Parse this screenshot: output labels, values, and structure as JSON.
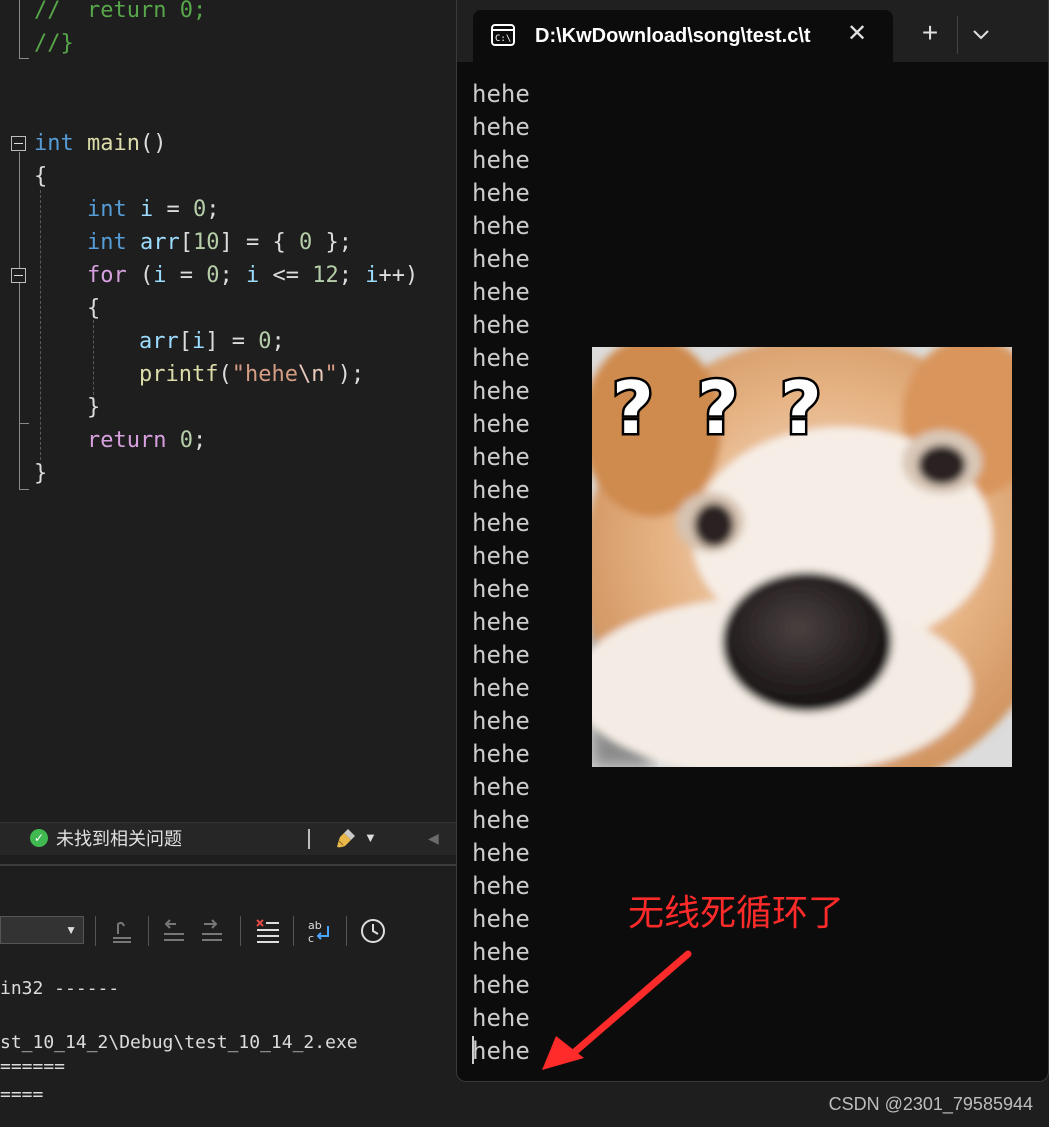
{
  "editor": {
    "lines": {
      "comment1_a": "//  ",
      "comment1_b": "return 0;",
      "comment2": "//}",
      "main_kw": "int",
      "main_fn": "main",
      "main_parens": "()",
      "open_brace": "{",
      "decl_i_kw": "int",
      "decl_i_name": "i",
      "decl_i_rest": " = ",
      "decl_i_val": "0",
      "decl_i_end": ";",
      "decl_arr_kw": "int",
      "decl_arr_name": "arr",
      "decl_arr_open": "[",
      "decl_arr_size": "10",
      "decl_arr_mid": "] = { ",
      "decl_arr_val": "0",
      "decl_arr_end": " };",
      "for_kw": "for",
      "for_a": " (",
      "for_i1": "i",
      "for_b": " = ",
      "for_n0": "0",
      "for_c": "; ",
      "for_i2": "i",
      "for_d": " <= ",
      "for_n12": "12",
      "for_e": "; ",
      "for_i3": "i",
      "for_f": "++)",
      "inner_open": "{",
      "assign_arr": "arr",
      "assign_open": "[",
      "assign_i": "i",
      "assign_mid": "] = ",
      "assign_val": "0",
      "assign_end": ";",
      "printf_fn": "printf",
      "printf_open": "(",
      "printf_str": "\"hehe",
      "printf_esc": "\\n",
      "printf_strend": "\"",
      "printf_end": ");",
      "inner_close": "}",
      "return_kw": "return",
      "return_val": "0",
      "return_end": ";",
      "close_brace": "}"
    }
  },
  "statusbar": {
    "issues_text": "未找到相关问题"
  },
  "output": {
    "line1": "in32 ------",
    "line2": "st_10_14_2\\Debug\\test_10_14_2.exe",
    "line3": "======",
    "line4": "===="
  },
  "terminal": {
    "tab_title": "D:\\KwDownload\\song\\test.c\\t",
    "close_symbol": "✕",
    "new_tab_symbol": "+",
    "output_lines": [
      "hehe",
      "hehe",
      "hehe",
      "hehe",
      "hehe",
      "hehe",
      "hehe",
      "hehe",
      "hehe",
      "hehe",
      "hehe",
      "hehe",
      "hehe",
      "hehe",
      "hehe",
      "hehe",
      "hehe",
      "hehe",
      "hehe",
      "hehe",
      "hehe",
      "hehe",
      "hehe",
      "hehe",
      "hehe",
      "hehe",
      "hehe",
      "hehe",
      "hehe",
      "hehe"
    ]
  },
  "meme": {
    "question_marks": [
      "?",
      "?",
      "?"
    ],
    "caption": "无线死循环了"
  },
  "watermark": "CSDN @2301_79585944",
  "colors": {
    "editor_bg": "#1e1e1e",
    "terminal_bg": "#0c0c0c",
    "keyword": "#569cd6",
    "control_keyword": "#d8a0df",
    "function": "#dcdcaa",
    "variable": "#9cdcfe",
    "number": "#b5cea8",
    "string": "#d69d85",
    "comment": "#57a64a",
    "caption_red": "#ff2a2a",
    "success_green": "#3fb950"
  },
  "icons": {
    "tab_icon": "console-icon",
    "status_ok": "check-circle-icon",
    "status_tool": "brush-icon",
    "dropdown": "chevron-down-icon"
  }
}
